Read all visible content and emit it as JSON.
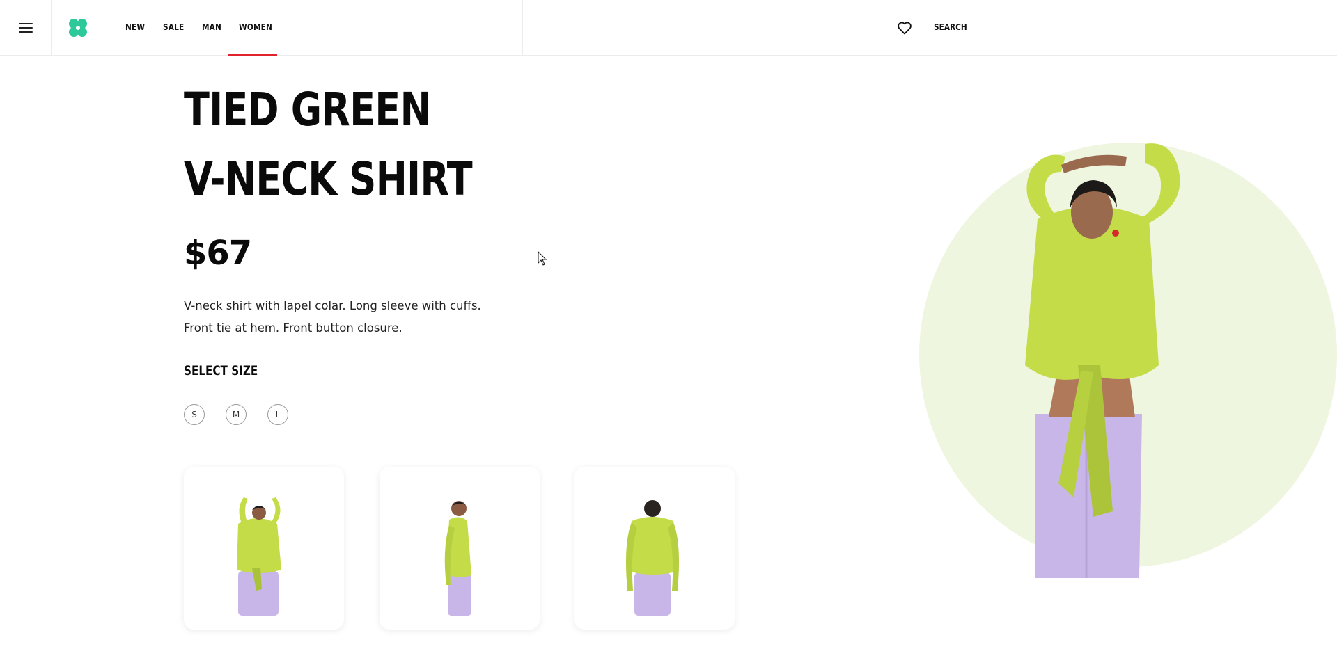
{
  "header": {
    "menu_icon": "hamburger-icon",
    "logo_icon": "clover-logo-icon",
    "nav": [
      "NEW",
      "SALE",
      "MAN",
      "WOMEN"
    ],
    "active_nav": "WOMEN",
    "wishlist_icon": "heart-icon",
    "search_label": "SEARCH"
  },
  "product": {
    "title_line1": "TIED GREEN",
    "title_line2": "V-NECK SHIRT",
    "price": "$67",
    "desc_line1": "V-neck shirt with lapel colar. Long sleeve with cuffs.",
    "desc_line2": "Front tie at hem. Front button closure.",
    "size_label": "SELECT SIZE",
    "sizes": [
      "S",
      "M",
      "L"
    ]
  },
  "colors": {
    "accent": "#e0222d",
    "logo": "#2ec99a",
    "shirt": "#c3dc48",
    "pants": "#c9b6e8",
    "hero_bg": "#eef6e0"
  }
}
